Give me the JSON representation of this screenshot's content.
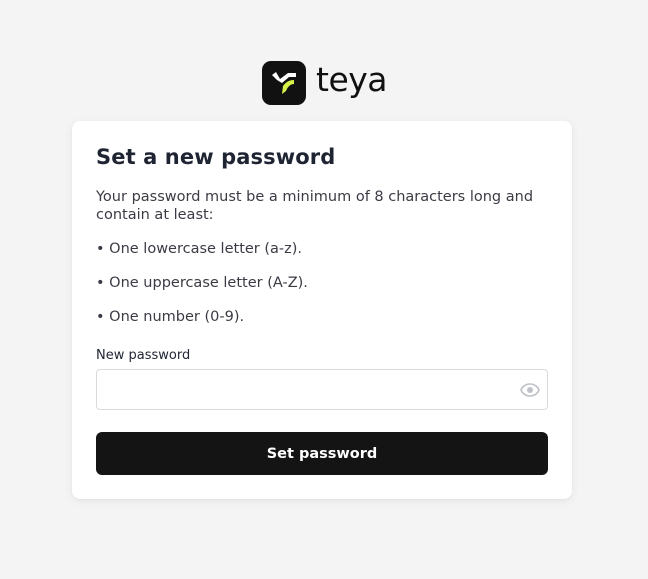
{
  "brand": {
    "name": "teya",
    "icon": "teya-logo-icon",
    "accent_color": "#d6f24a",
    "mark_color": "#111111"
  },
  "card": {
    "title": "Set a new password",
    "intro": "Your password must be a minimum of 8 characters long and contain at least:",
    "requirements": [
      "• One lowercase letter (a-z).",
      "• One uppercase letter (A-Z).",
      "• One number (0-9)."
    ]
  },
  "form": {
    "password_label": "New password",
    "password_value": "",
    "password_placeholder": "",
    "toggle_icon": "eye-icon",
    "submit_label": "Set password"
  },
  "colors": {
    "page_background": "#f4f4f4",
    "card_background": "#ffffff",
    "button_background": "#141414",
    "button_text": "#ffffff"
  }
}
